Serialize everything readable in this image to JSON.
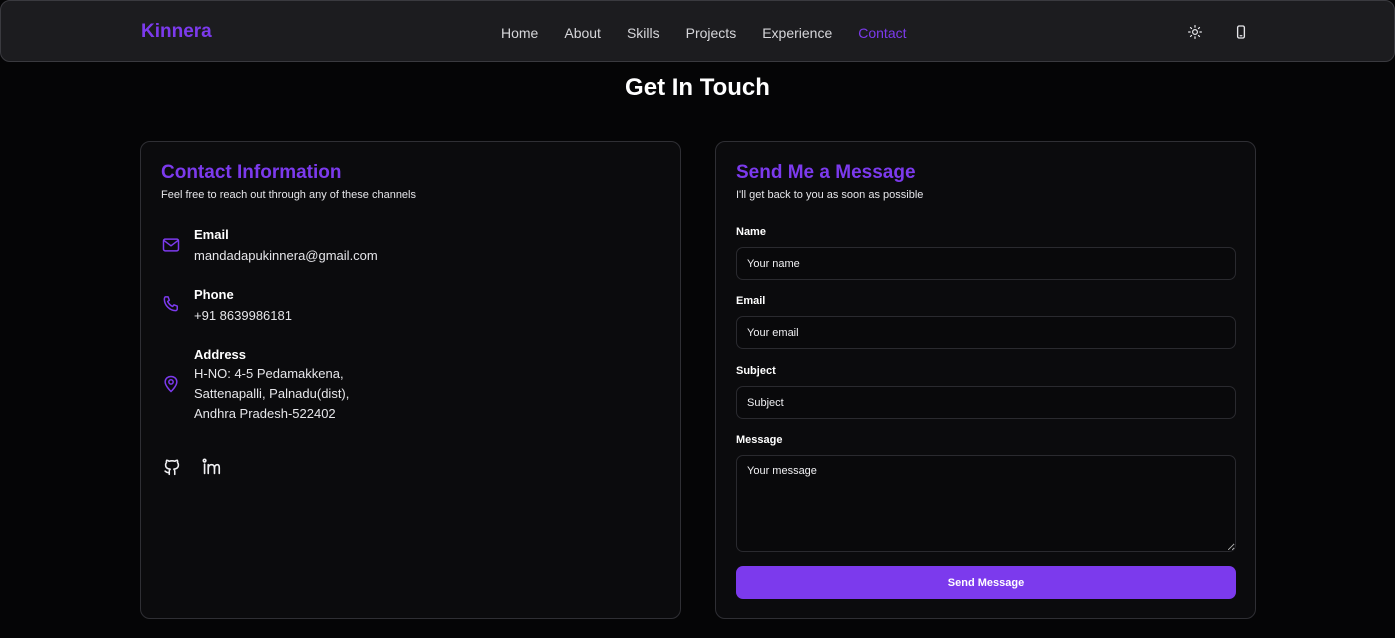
{
  "nav": {
    "brand": "Kinnera",
    "links": [
      "Home",
      "About",
      "Skills",
      "Projects",
      "Experience",
      "Contact"
    ],
    "active": "Contact",
    "icons": [
      "sun-icon",
      "phone-device-icon"
    ]
  },
  "page": {
    "title": "Get In Touch"
  },
  "contact": {
    "title": "Contact Information",
    "subtitle": "Feel free to reach out through any of these channels",
    "email": {
      "label": "Email",
      "value": "mandadapukinnera@gmail.com",
      "icon": "mail-icon"
    },
    "phone": {
      "label": "Phone",
      "value": "+91 8639986181",
      "icon": "phone-icon"
    },
    "address": {
      "label": "Address",
      "lines": [
        "H-NO: 4-5 Pedamakkena,",
        "Sattenapalli, Palnadu(dist),",
        "Andhra Pradesh-522402"
      ],
      "icon": "map-pin-icon"
    },
    "social": [
      "github-icon",
      "linkedin-icon"
    ]
  },
  "form": {
    "title": "Send Me a Message",
    "subtitle": "I'll get back to you as soon as possible",
    "name": {
      "label": "Name",
      "placeholder": "Your name",
      "value": ""
    },
    "email": {
      "label": "Email",
      "placeholder": "Your email",
      "value": ""
    },
    "subject": {
      "label": "Subject",
      "placeholder": "Subject",
      "value": ""
    },
    "message": {
      "label": "Message",
      "placeholder": "Your message",
      "value": ""
    },
    "submit_label": "Send Message"
  },
  "colors": {
    "accent": "#7c3aed",
    "background": "#050506",
    "card": "#0b0b0d",
    "navbar": "#1c1c1f"
  }
}
